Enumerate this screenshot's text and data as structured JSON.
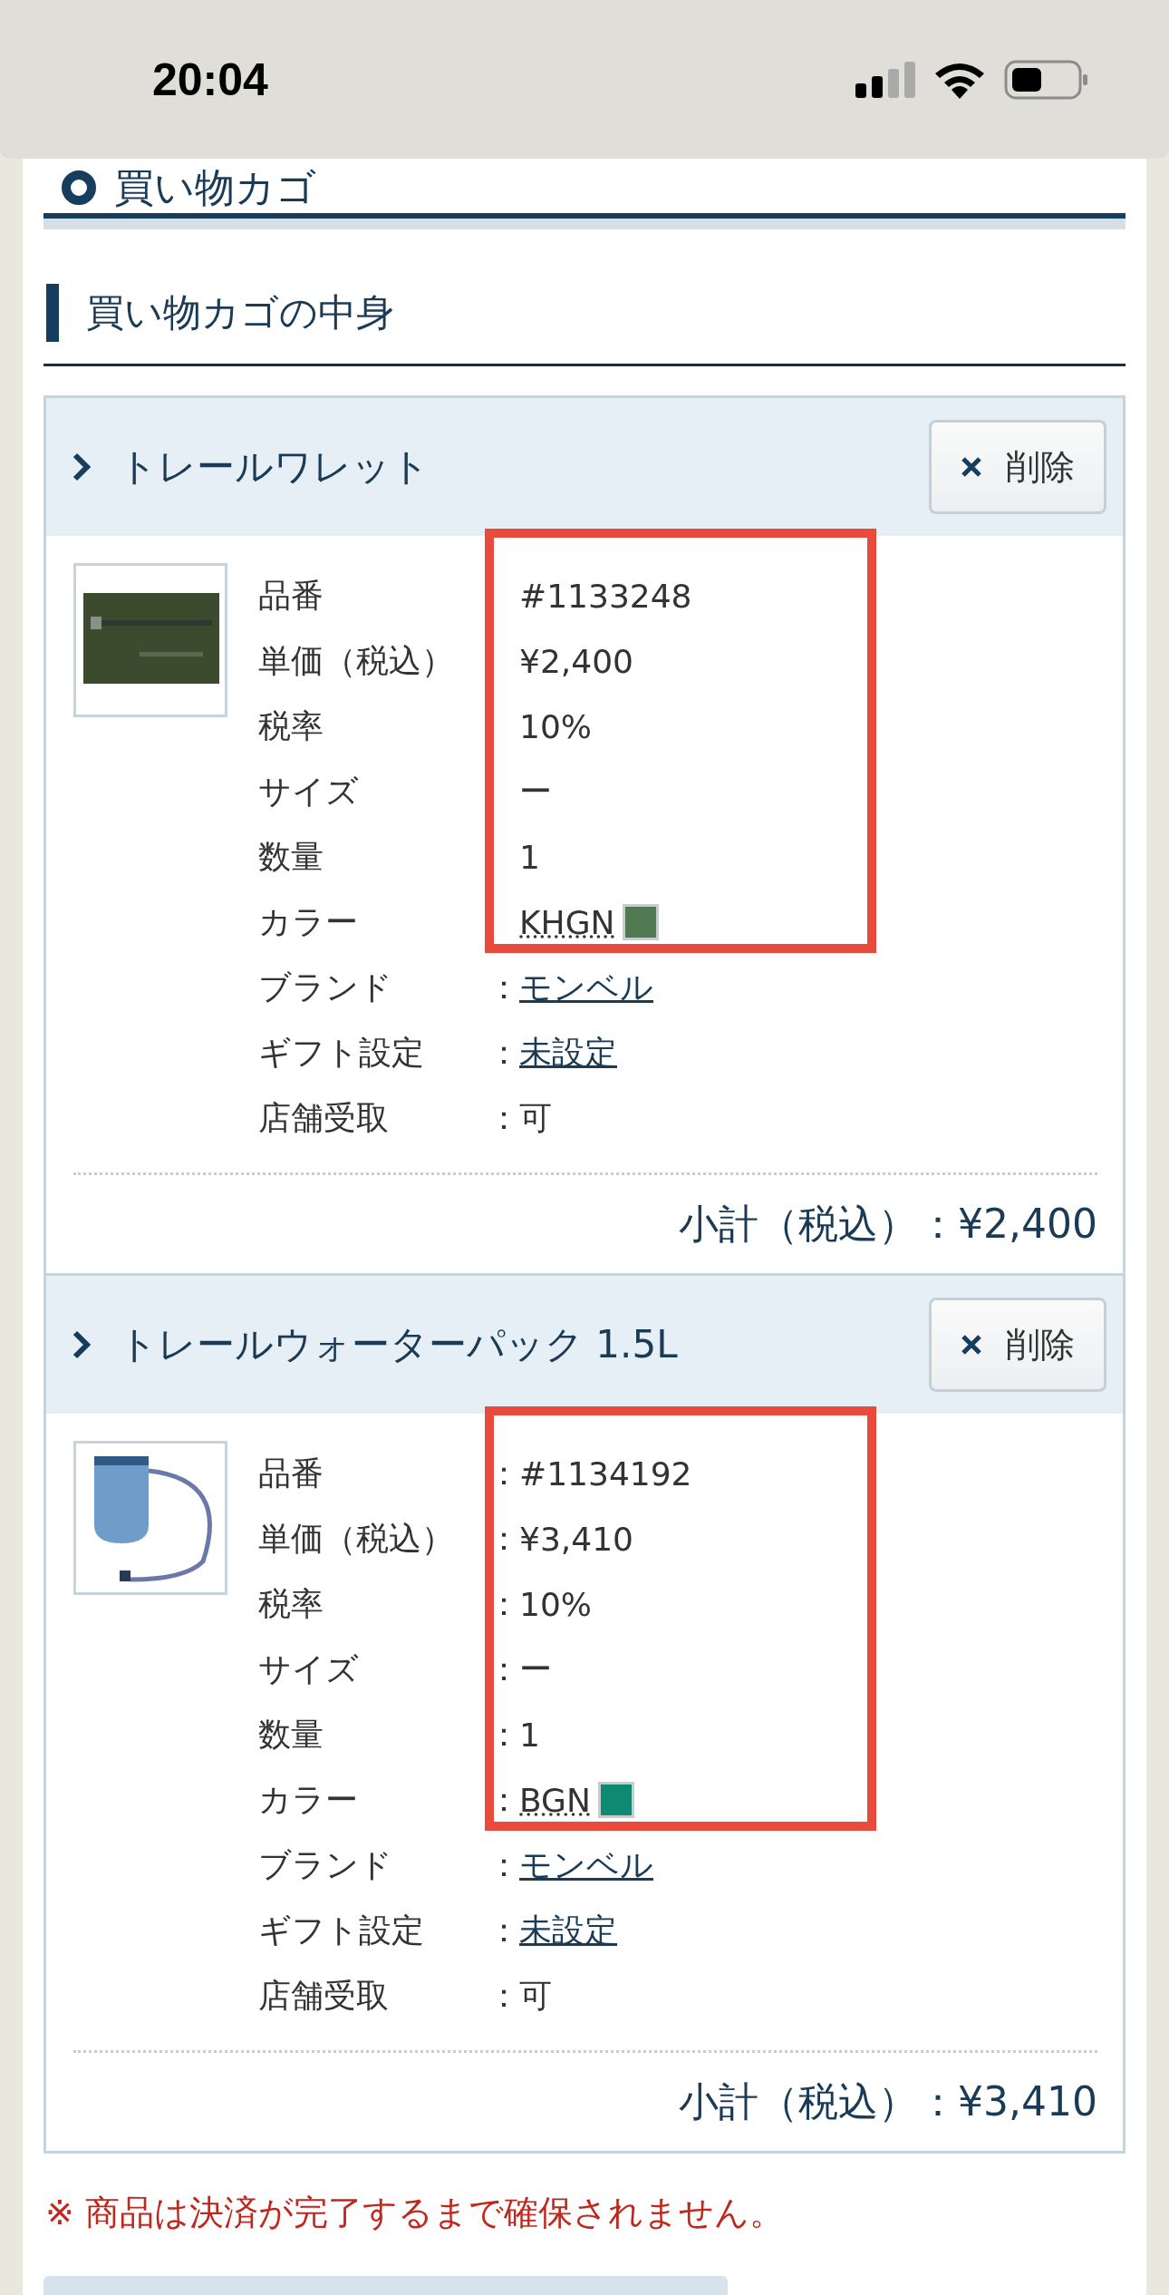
{
  "status_bar": {
    "time": "20:04"
  },
  "page_title": "買い物カゴ",
  "section_title": "買い物カゴの中身",
  "items": [
    {
      "name": "トレールワレット",
      "delete_label": "削除",
      "highlighted_rows": [
        {
          "label": "品番",
          "value": "#1133248",
          "kind": "text"
        },
        {
          "label": "単価（税込）",
          "value": "¥2,400",
          "kind": "text"
        },
        {
          "label": "税率",
          "value": "10%",
          "kind": "text"
        },
        {
          "label": "サイズ",
          "value": "ー",
          "kind": "text"
        },
        {
          "label": "数量",
          "value": "1",
          "kind": "text"
        },
        {
          "label": "カラー",
          "value": "KHGN",
          "kind": "color",
          "color": "#4f7a52"
        }
      ],
      "rows": [
        {
          "label": "ブランド",
          "separator": "：",
          "value": "モンベル",
          "kind": "link"
        },
        {
          "label": "ギフト設定",
          "separator": "：",
          "value": "未設定",
          "kind": "link"
        },
        {
          "label": "店舗受取",
          "separator": "：",
          "value": "可",
          "kind": "text"
        }
      ],
      "subtotal_label": "小計（税込）",
      "subtotal_separator": "：",
      "subtotal": "¥2,400"
    },
    {
      "name": "トレールウォーターパック 1.5L",
      "delete_label": "削除",
      "highlighted_rows": [
        {
          "label": "品番",
          "separator": "：",
          "value": "#1134192",
          "kind": "text"
        },
        {
          "label": "単価（税込）",
          "separator": "：",
          "value": "¥3,410",
          "kind": "text"
        },
        {
          "label": "税率",
          "separator": "：",
          "value": "10%",
          "kind": "text"
        },
        {
          "label": "サイズ",
          "separator": "：",
          "value": "ー",
          "kind": "text"
        },
        {
          "label": "数量",
          "separator": "：",
          "value": "1",
          "kind": "text"
        },
        {
          "label": "カラー",
          "separator": "：",
          "value": "BGN",
          "kind": "color",
          "color": "#0e8a72"
        }
      ],
      "rows": [
        {
          "label": "ブランド",
          "separator": "：",
          "value": "モンベル",
          "kind": "link"
        },
        {
          "label": "ギフト設定",
          "separator": "：",
          "value": "未設定",
          "kind": "link"
        },
        {
          "label": "店舗受取",
          "separator": "：",
          "value": "可",
          "kind": "text"
        }
      ],
      "subtotal_label": "小計（税込）",
      "subtotal_separator": "：",
      "subtotal": "¥3,410"
    }
  ],
  "notice": "※ 商品は決済が完了するまで確保されません。"
}
